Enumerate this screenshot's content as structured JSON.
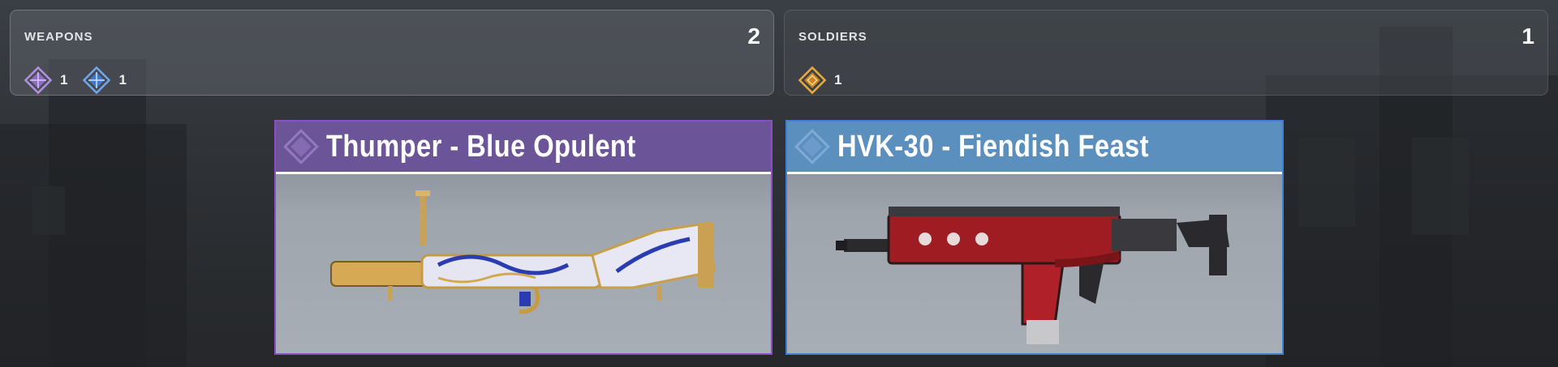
{
  "summary": {
    "weapons": {
      "title": "WEAPONS",
      "count": "2",
      "items": [
        {
          "icon": "purple-rarity-diamond-icon",
          "color": "#b08fe0",
          "value": "1"
        },
        {
          "icon": "blue-rarity-diamond-icon",
          "color": "#6ea6e8",
          "value": "1"
        }
      ]
    },
    "soldiers": {
      "title": "SOLDIERS",
      "count": "1",
      "items": [
        {
          "icon": "gold-rarity-diamond-icon",
          "color": "#e7a83d",
          "value": "1"
        }
      ]
    }
  },
  "cards": [
    {
      "title": "Thumper - Blue Opulent",
      "rarity": "purple",
      "accent": "#6c5498",
      "image": "grenade-launcher-weapon-image"
    },
    {
      "title": "HVK-30 - Fiendish Feast",
      "rarity": "blue",
      "accent": "#5b8fbe",
      "image": "assault-rifle-weapon-image"
    }
  ]
}
